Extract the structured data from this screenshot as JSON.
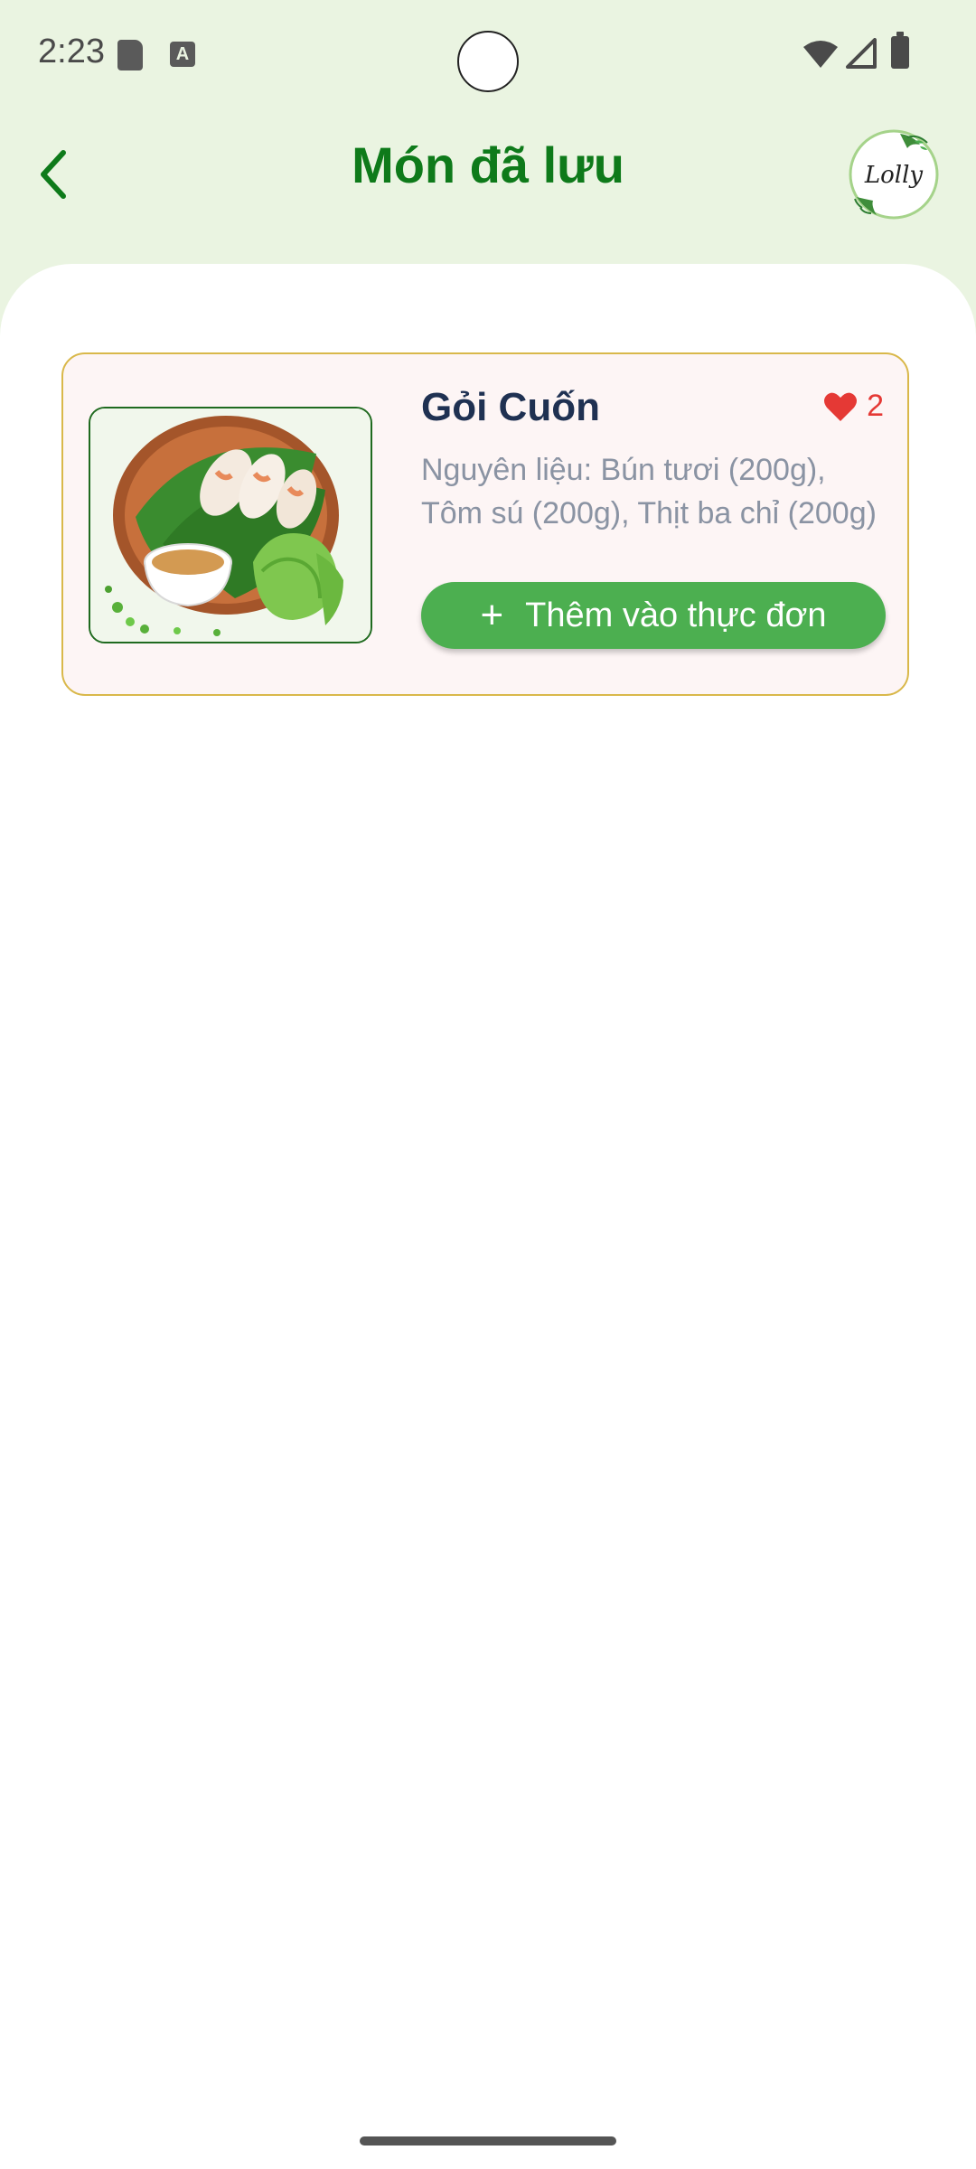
{
  "status_bar": {
    "time": "2:23",
    "a_icon_label": "A"
  },
  "header": {
    "title": "Món đã lưu",
    "logo_text": "Lolly",
    "background_color": "#eaf4e1",
    "title_color": "#0e7a1a"
  },
  "saved_items": [
    {
      "name": "Gỏi Cuốn",
      "favorite_count": "2",
      "description": "Nguyên liệu: Bún tươi (200g), Tôm sú (200g), Thịt ba chỉ (200g)",
      "add_button_label": "Thêm vào thực đơn",
      "add_icon": "+"
    }
  ],
  "colors": {
    "accent_green": "#4caf50",
    "card_border": "#d9b84a",
    "heart": "#e53935"
  },
  "icons": [
    "back-arrow-icon",
    "heart-icon",
    "plus-icon",
    "wifi-icon",
    "signal-icon",
    "battery-icon",
    "sd-card-icon"
  ]
}
